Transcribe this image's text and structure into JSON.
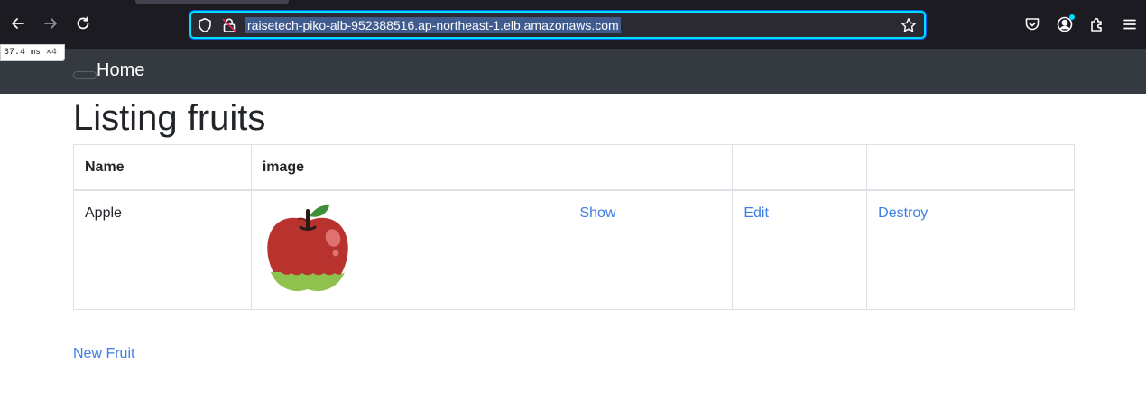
{
  "browser": {
    "url": "raisetech-piko-alb-952388516.ap-northeast-1.elb.amazonaws.com",
    "back_icon": "arrow-left-icon",
    "forward_icon": "arrow-right-icon",
    "reload_icon": "reload-icon",
    "toolbar_icons": [
      "pocket-icon",
      "account-icon",
      "extensions-icon",
      "menu-icon"
    ],
    "accent_color": "#00ddff",
    "selection_color": "#405c8f"
  },
  "timing": {
    "value": "37.4",
    "unit": "ms",
    "multiplier": "✕4"
  },
  "navbar": {
    "home_label": "Home",
    "background": "#343a40"
  },
  "main": {
    "title": "Listing fruits",
    "table": {
      "headers": [
        "Name",
        "image",
        "",
        "",
        ""
      ],
      "rows": [
        {
          "name": "Apple",
          "image_icon": "apple-image",
          "show_label": "Show",
          "edit_label": "Edit",
          "destroy_label": "Destroy"
        }
      ]
    },
    "new_fruit_label": "New Fruit",
    "link_color": "#3c7ee6"
  }
}
